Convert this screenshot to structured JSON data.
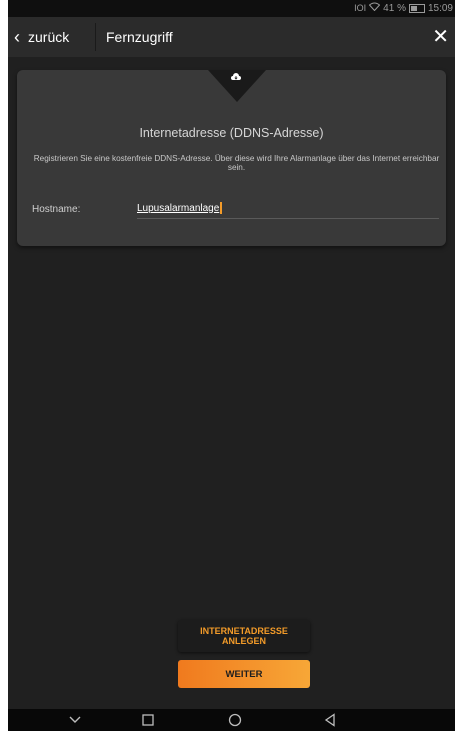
{
  "status": {
    "icons_text": "‘’ ¥41 %",
    "signal": "ⅡıⅡ",
    "wifi_label": "41 %",
    "time": "15:09"
  },
  "header": {
    "back_label": "zurück",
    "title": "Fernzugriff",
    "close_icon": "close-icon"
  },
  "card": {
    "title": "Internetadresse (DDNS-Adresse)",
    "description": "Registrieren Sie eine kostenfreie DDNS-Adresse. Über diese wird Ihre Alarmanlage über das Internet erreichbar sein.",
    "hostname_label": "Hostname:",
    "hostname_value": "Lupusalarmanlage",
    "icon": "cloud-icon"
  },
  "buttons": {
    "create_line1": "INTERNETADRESSE",
    "create_line2": "ANLEGEN",
    "next": "WEITER"
  },
  "navbar": {
    "icons": [
      "chevron-down-icon",
      "square-icon",
      "circle-icon",
      "triangle-back-icon"
    ]
  },
  "colors": {
    "accent": "#f39b29",
    "background": "#202020",
    "card": "#393939",
    "topbar": "#2b2b2b"
  }
}
